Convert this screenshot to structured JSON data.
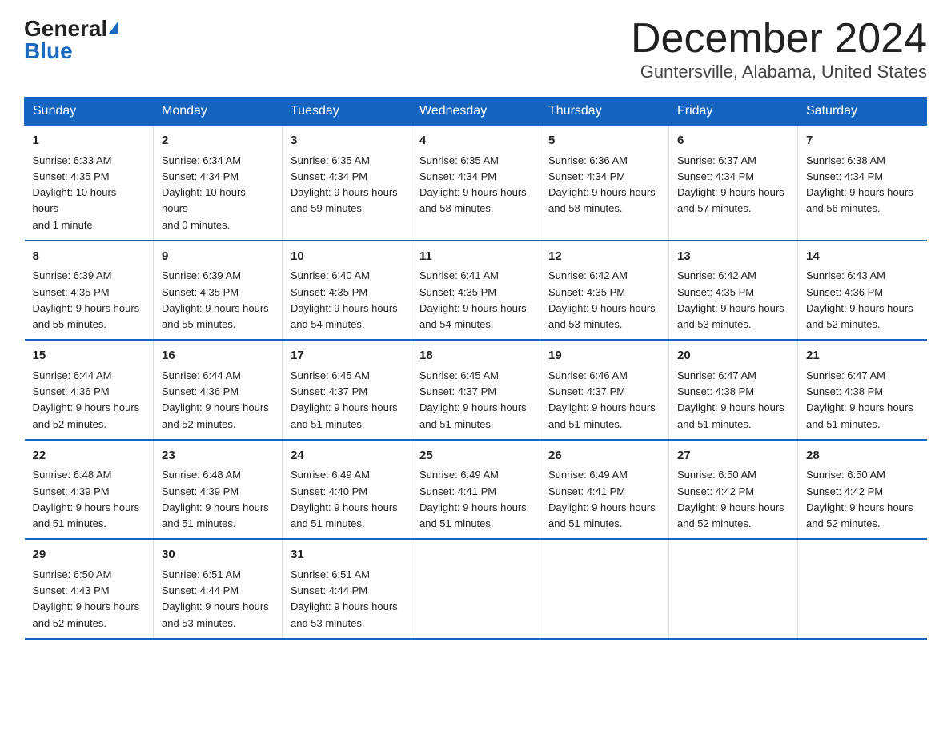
{
  "logo": {
    "general": "General",
    "blue": "Blue"
  },
  "title": "December 2024",
  "subtitle": "Guntersville, Alabama, United States",
  "weekdays": [
    "Sunday",
    "Monday",
    "Tuesday",
    "Wednesday",
    "Thursday",
    "Friday",
    "Saturday"
  ],
  "weeks": [
    [
      {
        "day": "1",
        "sunrise": "6:33 AM",
        "sunset": "4:35 PM",
        "daylight": "10 hours and 1 minute."
      },
      {
        "day": "2",
        "sunrise": "6:34 AM",
        "sunset": "4:34 PM",
        "daylight": "10 hours and 0 minutes."
      },
      {
        "day": "3",
        "sunrise": "6:35 AM",
        "sunset": "4:34 PM",
        "daylight": "9 hours and 59 minutes."
      },
      {
        "day": "4",
        "sunrise": "6:35 AM",
        "sunset": "4:34 PM",
        "daylight": "9 hours and 58 minutes."
      },
      {
        "day": "5",
        "sunrise": "6:36 AM",
        "sunset": "4:34 PM",
        "daylight": "9 hours and 58 minutes."
      },
      {
        "day": "6",
        "sunrise": "6:37 AM",
        "sunset": "4:34 PM",
        "daylight": "9 hours and 57 minutes."
      },
      {
        "day": "7",
        "sunrise": "6:38 AM",
        "sunset": "4:34 PM",
        "daylight": "9 hours and 56 minutes."
      }
    ],
    [
      {
        "day": "8",
        "sunrise": "6:39 AM",
        "sunset": "4:35 PM",
        "daylight": "9 hours and 55 minutes."
      },
      {
        "day": "9",
        "sunrise": "6:39 AM",
        "sunset": "4:35 PM",
        "daylight": "9 hours and 55 minutes."
      },
      {
        "day": "10",
        "sunrise": "6:40 AM",
        "sunset": "4:35 PM",
        "daylight": "9 hours and 54 minutes."
      },
      {
        "day": "11",
        "sunrise": "6:41 AM",
        "sunset": "4:35 PM",
        "daylight": "9 hours and 54 minutes."
      },
      {
        "day": "12",
        "sunrise": "6:42 AM",
        "sunset": "4:35 PM",
        "daylight": "9 hours and 53 minutes."
      },
      {
        "day": "13",
        "sunrise": "6:42 AM",
        "sunset": "4:35 PM",
        "daylight": "9 hours and 53 minutes."
      },
      {
        "day": "14",
        "sunrise": "6:43 AM",
        "sunset": "4:36 PM",
        "daylight": "9 hours and 52 minutes."
      }
    ],
    [
      {
        "day": "15",
        "sunrise": "6:44 AM",
        "sunset": "4:36 PM",
        "daylight": "9 hours and 52 minutes."
      },
      {
        "day": "16",
        "sunrise": "6:44 AM",
        "sunset": "4:36 PM",
        "daylight": "9 hours and 52 minutes."
      },
      {
        "day": "17",
        "sunrise": "6:45 AM",
        "sunset": "4:37 PM",
        "daylight": "9 hours and 51 minutes."
      },
      {
        "day": "18",
        "sunrise": "6:45 AM",
        "sunset": "4:37 PM",
        "daylight": "9 hours and 51 minutes."
      },
      {
        "day": "19",
        "sunrise": "6:46 AM",
        "sunset": "4:37 PM",
        "daylight": "9 hours and 51 minutes."
      },
      {
        "day": "20",
        "sunrise": "6:47 AM",
        "sunset": "4:38 PM",
        "daylight": "9 hours and 51 minutes."
      },
      {
        "day": "21",
        "sunrise": "6:47 AM",
        "sunset": "4:38 PM",
        "daylight": "9 hours and 51 minutes."
      }
    ],
    [
      {
        "day": "22",
        "sunrise": "6:48 AM",
        "sunset": "4:39 PM",
        "daylight": "9 hours and 51 minutes."
      },
      {
        "day": "23",
        "sunrise": "6:48 AM",
        "sunset": "4:39 PM",
        "daylight": "9 hours and 51 minutes."
      },
      {
        "day": "24",
        "sunrise": "6:49 AM",
        "sunset": "4:40 PM",
        "daylight": "9 hours and 51 minutes."
      },
      {
        "day": "25",
        "sunrise": "6:49 AM",
        "sunset": "4:41 PM",
        "daylight": "9 hours and 51 minutes."
      },
      {
        "day": "26",
        "sunrise": "6:49 AM",
        "sunset": "4:41 PM",
        "daylight": "9 hours and 51 minutes."
      },
      {
        "day": "27",
        "sunrise": "6:50 AM",
        "sunset": "4:42 PM",
        "daylight": "9 hours and 52 minutes."
      },
      {
        "day": "28",
        "sunrise": "6:50 AM",
        "sunset": "4:42 PM",
        "daylight": "9 hours and 52 minutes."
      }
    ],
    [
      {
        "day": "29",
        "sunrise": "6:50 AM",
        "sunset": "4:43 PM",
        "daylight": "9 hours and 52 minutes."
      },
      {
        "day": "30",
        "sunrise": "6:51 AM",
        "sunset": "4:44 PM",
        "daylight": "9 hours and 53 minutes."
      },
      {
        "day": "31",
        "sunrise": "6:51 AM",
        "sunset": "4:44 PM",
        "daylight": "9 hours and 53 minutes."
      },
      null,
      null,
      null,
      null
    ]
  ],
  "sunrise_label": "Sunrise:",
  "sunset_label": "Sunset:",
  "daylight_label": "Daylight:"
}
